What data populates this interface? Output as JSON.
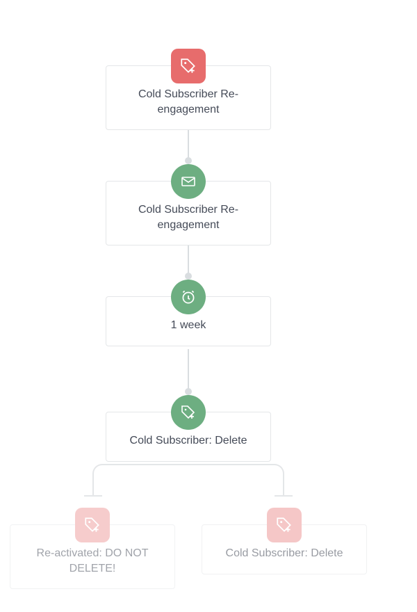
{
  "nodes": {
    "n1": {
      "label": "Cold Subscriber Re-engagement",
      "icon": "tag-add-icon",
      "badge_color": "red"
    },
    "n2": {
      "label": "Cold Subscriber Re-engagement",
      "icon": "envelope-icon",
      "badge_color": "green"
    },
    "n3": {
      "label": "1 week",
      "icon": "clock-icon",
      "badge_color": "green"
    },
    "n4": {
      "label": "Cold Subscriber: Delete",
      "icon": "tag-add-icon",
      "badge_color": "green"
    },
    "n5": {
      "label": "Re-activated: DO NOT DELETE!",
      "icon": "tag-add-icon",
      "badge_color": "red-faded"
    },
    "n6": {
      "label": "Cold Subscriber: Delete",
      "icon": "tag-add-icon",
      "badge_color": "red-faded"
    }
  },
  "flow": {
    "trunk": [
      "n1",
      "n2",
      "n3",
      "n4"
    ],
    "split_from": "n4",
    "branches": [
      "n5",
      "n6"
    ]
  },
  "colors": {
    "red": "#e76c6c",
    "green": "#6dae81",
    "border": "#e4e6e8",
    "text": "#444a57"
  }
}
